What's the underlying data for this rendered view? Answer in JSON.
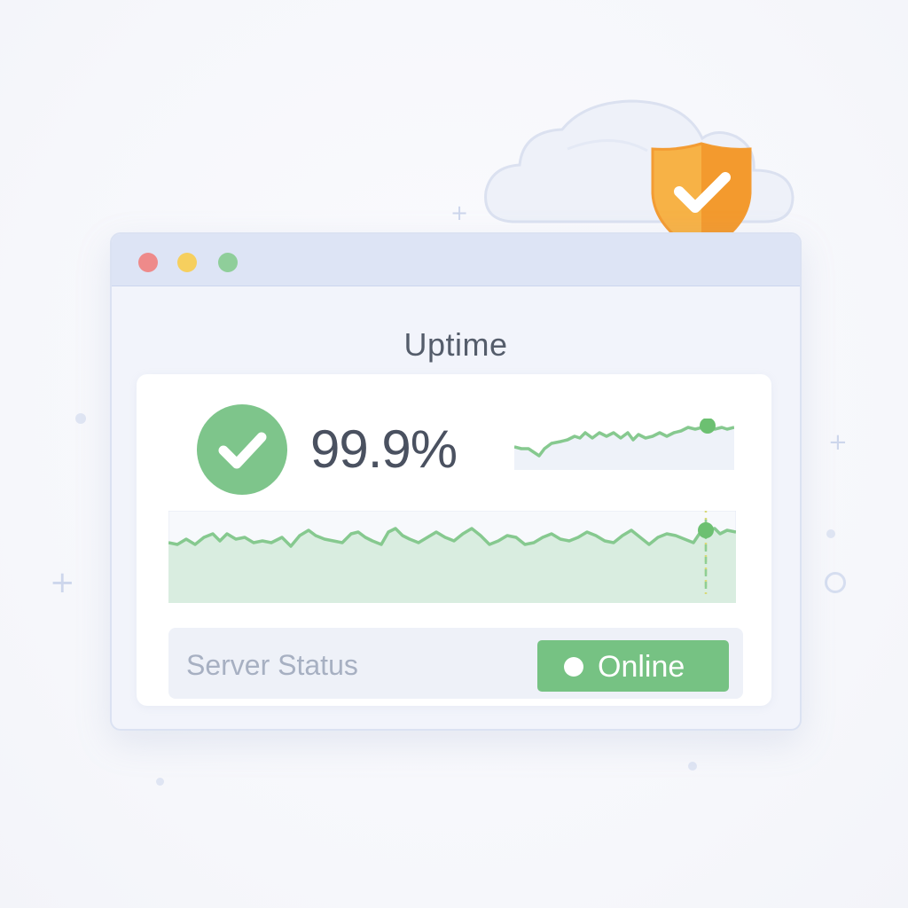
{
  "window": {
    "title": "Uptime",
    "controls": [
      "close",
      "minimize",
      "maximize"
    ]
  },
  "uptime": {
    "value": "99.9%",
    "status_icon": "check-icon"
  },
  "status": {
    "label": "Server Status",
    "badge_label": "Online",
    "badge_color": "#76c283"
  },
  "colors": {
    "accent_green": "#7ec58b",
    "shield_orange": "#f39c33",
    "window_chrome": "#dde4f5"
  },
  "decorations": {
    "cloud_icon": "cloud-icon",
    "shield_icon": "shield-check-icon"
  }
}
